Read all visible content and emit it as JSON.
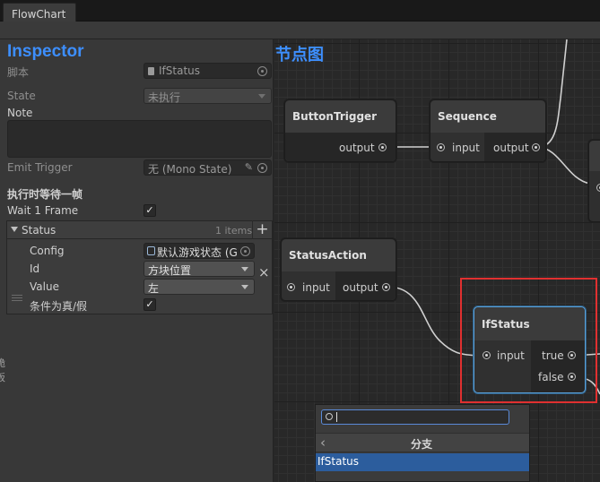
{
  "window": {
    "tab_title": "FlowChart"
  },
  "inspector": {
    "title": "Inspector",
    "script_label": "脚本",
    "script_value": "IfStatus",
    "state_label": "State",
    "state_value": "未执行",
    "note_label": "Note",
    "emit_trigger_label": "Emit Trigger",
    "emit_trigger_value": "无 (Mono State)",
    "section_label": "执行时等待一帧",
    "wait_label": "Wait 1 Frame",
    "wait_checked": "✓",
    "status_label": "Status",
    "status_count": "1 items",
    "add_icon": "+",
    "remove_icon": "×",
    "config_label": "Config",
    "config_value": "默认游戏状态 (G",
    "id_label": "Id",
    "id_value": "方块位置",
    "value_label": "Value",
    "value_value": "左",
    "condition_label": "条件为真/假",
    "condition_checked": "✓"
  },
  "graph": {
    "title": "节点图",
    "nodes": {
      "button_trigger": {
        "title": "ButtonTrigger",
        "output": "output"
      },
      "sequence": {
        "title": "Sequence",
        "input": "input",
        "output": "output"
      },
      "status_action": {
        "title": "StatusAction",
        "input": "input",
        "output": "output"
      },
      "if_status": {
        "title": "IfStatus",
        "input": "input",
        "true": "true",
        "false": "false"
      }
    }
  },
  "search_popup": {
    "query": "",
    "back_icon": "‹",
    "category": "分支",
    "selected_item": "IfStatus"
  },
  "left_edge": {
    "line1": "脆",
    "line2": "板"
  },
  "colors": {
    "accent_blue": "#3d8fff",
    "highlight_red": "#e03030",
    "selection_blue": "#2c5d9d",
    "selected_node_border": "#5aa0d8"
  }
}
